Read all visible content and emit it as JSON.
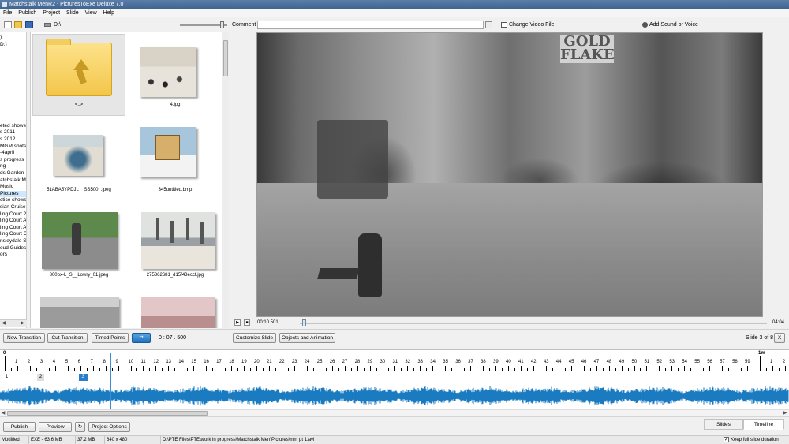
{
  "window": {
    "title": "Matchstalk MenR2 - PicturesToExe Deluxe 7.0"
  },
  "menu": [
    "File",
    "Publish",
    "Project",
    "Slide",
    "View",
    "Help"
  ],
  "toolbar": {
    "path": "D:\\",
    "comment_label": "Comment",
    "comment_value": "",
    "change_video_label": "Change Video File",
    "add_sound_label": "Add Sound or Voice",
    "icons": {
      "new": "new-file-icon",
      "open": "open-folder-icon",
      "save": "save-icon",
      "drive": "drive-icon",
      "comment": "comment-edit-icon",
      "video": "video-file-icon",
      "sound": "sound-icon"
    }
  },
  "tree": {
    "items": [
      {
        "label": ")"
      },
      {
        "label": "D:)"
      },
      {
        "label": ""
      },
      {
        "label": ""
      },
      {
        "label": ""
      },
      {
        "label": ""
      },
      {
        "label": ""
      },
      {
        "label": ""
      },
      {
        "label": ""
      },
      {
        "label": ""
      },
      {
        "label": ""
      },
      {
        "label": ""
      },
      {
        "label": ""
      },
      {
        "label": "eted shows"
      },
      {
        "label": "s 2011"
      },
      {
        "label": "s 2012"
      },
      {
        "label": "MGM shots"
      },
      {
        "label": "-4april"
      },
      {
        "label": "s progress"
      },
      {
        "label": "ng"
      },
      {
        "label": "ds Garden"
      },
      {
        "label": "atchstalk Men"
      },
      {
        "label": "Music"
      },
      {
        "label": "Pictures",
        "selected": true
      },
      {
        "label": "ctice shows"
      },
      {
        "label": "sian Cruise"
      },
      {
        "label": "ling Court 2"
      },
      {
        "label": "ling Court A"
      },
      {
        "label": "ling Court A"
      },
      {
        "label": "ling Court C"
      },
      {
        "label": "nsleydale Sh"
      },
      {
        "label": "oud Guides &"
      },
      {
        "label": "ors"
      }
    ]
  },
  "files": [
    {
      "label": "<..>",
      "kind": "folder-up",
      "selected": true
    },
    {
      "label": "4.jpg",
      "kind": "lowry"
    },
    {
      "label": "51ABA5YPDJL__SS500_.jpeg",
      "kind": "crowd"
    },
    {
      "label": "345untitled.bmp",
      "kind": "house"
    },
    {
      "label": "800px-L_S__Lowry_01.jpeg",
      "kind": "statue"
    },
    {
      "label": "275362681_d15f43eccf.jpg",
      "kind": "industry"
    },
    {
      "label": "",
      "kind": "mural"
    },
    {
      "label": "",
      "kind": "pink"
    }
  ],
  "video": {
    "sign_text": "GOLD\nFLAKE"
  },
  "transport": {
    "elapsed": "00:10.501",
    "total": "04:04",
    "progress": 0.005
  },
  "buttons": {
    "new_transition": "New Transition",
    "cut_transition": "Cut Transition",
    "timed_points": "Timed Points",
    "duration": "0 : 07 . 500",
    "customize_slide": "Customize Slide",
    "objects_animation": "Objects and Animation",
    "slide_count": "Slide 3 of 8",
    "close": "X"
  },
  "timeline": {
    "start_label": "0",
    "end_label": "1m",
    "second_ticks": [
      "1",
      "2",
      "3",
      "4",
      "5",
      "6",
      "7",
      "8",
      "9",
      "10",
      "11",
      "12",
      "13",
      "14",
      "15",
      "16",
      "17",
      "18",
      "19",
      "20",
      "21",
      "22",
      "23",
      "24",
      "25",
      "26",
      "27",
      "28",
      "29",
      "30",
      "31",
      "32",
      "33",
      "34",
      "35",
      "36",
      "37",
      "38",
      "39",
      "40",
      "41",
      "42",
      "43",
      "44",
      "45",
      "46",
      "47",
      "48",
      "49",
      "50",
      "51",
      "52",
      "53",
      "54",
      "55",
      "56",
      "57",
      "58",
      "59",
      "1",
      "2",
      "3"
    ],
    "slides": [
      {
        "label": "1",
        "active": false,
        "time": 0
      },
      {
        "label": "2",
        "active": false,
        "time": 2.7
      },
      {
        "label": "3",
        "active": true,
        "time": 6.0
      }
    ],
    "playhead_time": 8.4,
    "wave_color": "#1a7bc1"
  },
  "bottom": {
    "publish": "Publish",
    "preview": "Preview",
    "project_options": "Project Options",
    "tab_slides": "Slides",
    "tab_timeline": "Timeline"
  },
  "status": {
    "state": "Modified",
    "exe": "EXE - 63.6 MB",
    "size": "37.2 MB",
    "resolution": "640 x 480",
    "path": "D:\\PTE Files\\PTE\\work in progress\\Matchstalk Men\\Pictures\\mm pt 1.avi",
    "keep_full_label": "Keep full slide duration",
    "keep_full_checked": true
  }
}
